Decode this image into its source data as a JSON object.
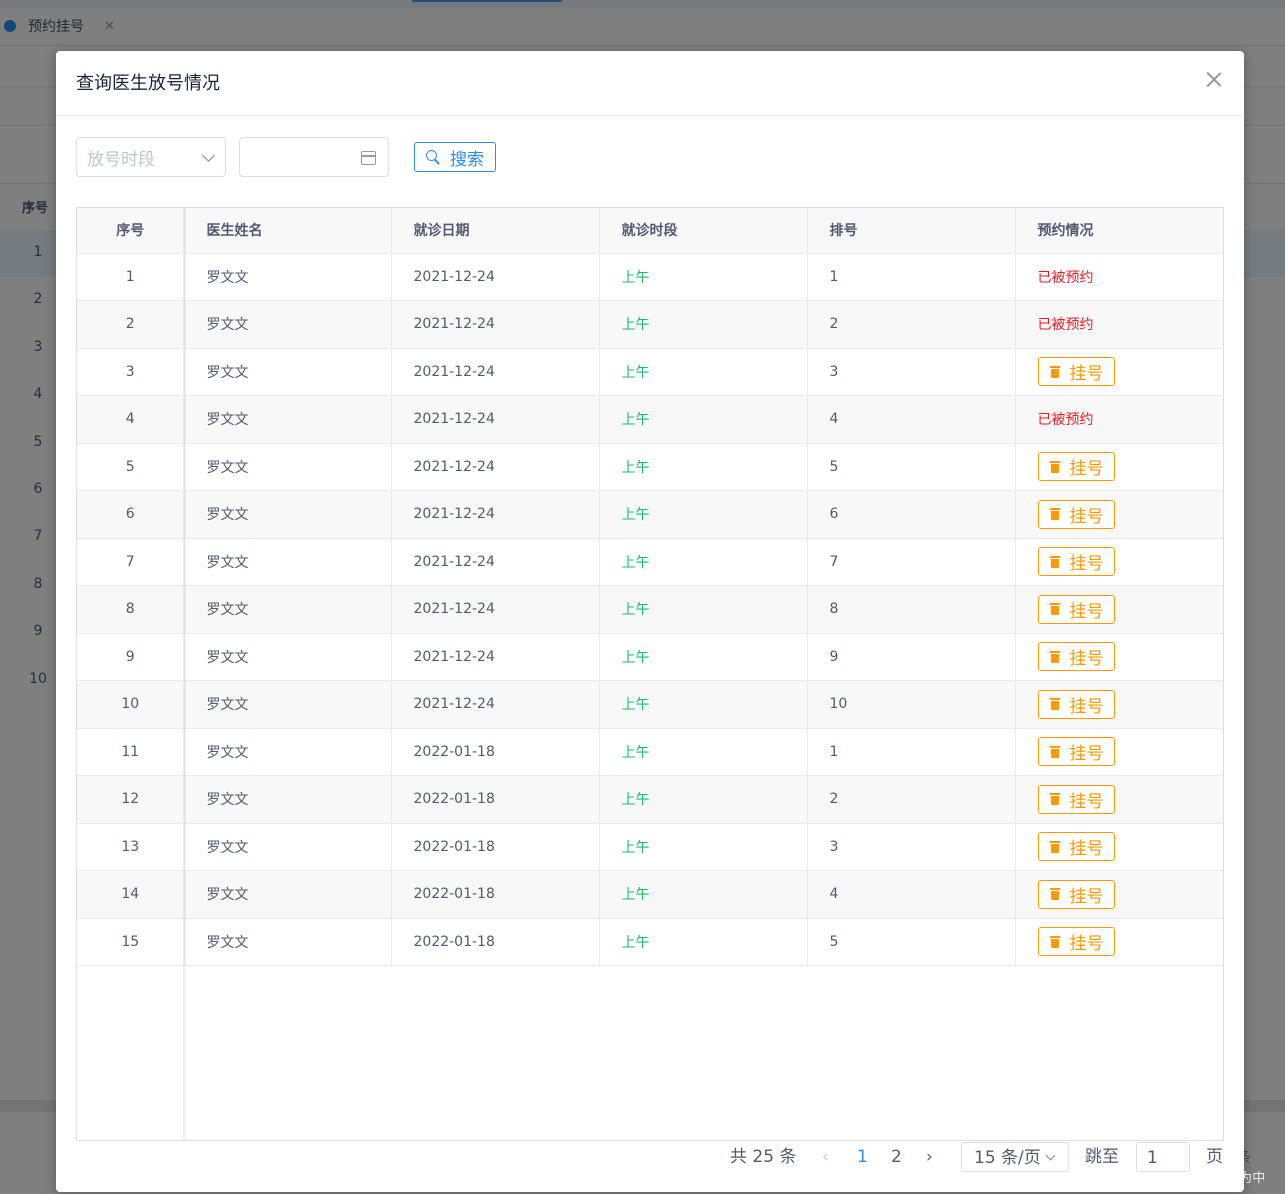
{
  "background": {
    "tab_label": "预约挂号",
    "tab_close": "✕",
    "table_seq_header": "序号",
    "seq_numbers": [
      "1",
      "2",
      "3",
      "4",
      "5",
      "6",
      "7",
      "8",
      "9",
      "10"
    ],
    "pager_tail": "条"
  },
  "dialog": {
    "title": "查询医生放号情况",
    "search": {
      "period_placeholder": "放号时段",
      "date_value": "",
      "search_label": "搜索"
    },
    "table": {
      "columns": [
        "序号",
        "医生姓名",
        "就诊日期",
        "就诊时段",
        "排号",
        "预约情况"
      ],
      "rows": [
        {
          "seq": "1",
          "doctor": "罗文文",
          "date": "2021-12-24",
          "period": "上午",
          "number": "1",
          "status": "已被预约"
        },
        {
          "seq": "2",
          "doctor": "罗文文",
          "date": "2021-12-24",
          "period": "上午",
          "number": "2",
          "status": "已被预约"
        },
        {
          "seq": "3",
          "doctor": "罗文文",
          "date": "2021-12-24",
          "period": "上午",
          "number": "3",
          "status": "挂号"
        },
        {
          "seq": "4",
          "doctor": "罗文文",
          "date": "2021-12-24",
          "period": "上午",
          "number": "4",
          "status": "已被预约"
        },
        {
          "seq": "5",
          "doctor": "罗文文",
          "date": "2021-12-24",
          "period": "上午",
          "number": "5",
          "status": "挂号"
        },
        {
          "seq": "6",
          "doctor": "罗文文",
          "date": "2021-12-24",
          "period": "上午",
          "number": "6",
          "status": "挂号"
        },
        {
          "seq": "7",
          "doctor": "罗文文",
          "date": "2021-12-24",
          "period": "上午",
          "number": "7",
          "status": "挂号"
        },
        {
          "seq": "8",
          "doctor": "罗文文",
          "date": "2021-12-24",
          "period": "上午",
          "number": "8",
          "status": "挂号"
        },
        {
          "seq": "9",
          "doctor": "罗文文",
          "date": "2021-12-24",
          "period": "上午",
          "number": "9",
          "status": "挂号"
        },
        {
          "seq": "10",
          "doctor": "罗文文",
          "date": "2021-12-24",
          "period": "上午",
          "number": "10",
          "status": "挂号"
        },
        {
          "seq": "11",
          "doctor": "罗文文",
          "date": "2022-01-18",
          "period": "上午",
          "number": "1",
          "status": "挂号"
        },
        {
          "seq": "12",
          "doctor": "罗文文",
          "date": "2022-01-18",
          "period": "上午",
          "number": "2",
          "status": "挂号"
        },
        {
          "seq": "13",
          "doctor": "罗文文",
          "date": "2022-01-18",
          "period": "上午",
          "number": "3",
          "status": "挂号"
        },
        {
          "seq": "14",
          "doctor": "罗文文",
          "date": "2022-01-18",
          "period": "上午",
          "number": "4",
          "status": "挂号"
        },
        {
          "seq": "15",
          "doctor": "罗文文",
          "date": "2022-01-18",
          "period": "上午",
          "number": "5",
          "status": "挂号"
        }
      ]
    },
    "pager": {
      "total": "共 25 条",
      "prev": "‹",
      "pages": [
        "1",
        "2"
      ],
      "next": "›",
      "page_size": "15 条/页",
      "jump_label": "跳至",
      "jump_value": "1",
      "page_suffix": "页"
    }
  },
  "watermark": "CSDN @郑为中",
  "colors": {
    "primary": "#2d8cf0",
    "period_green": "#19be6b",
    "booked_red": "#ed1c24",
    "register_orange": "#ff9900"
  },
  "icons": {
    "close": "close-icon",
    "chevron": "chevron-down-icon",
    "calendar": "calendar-icon",
    "search": "search-icon",
    "register": "trash-icon"
  }
}
